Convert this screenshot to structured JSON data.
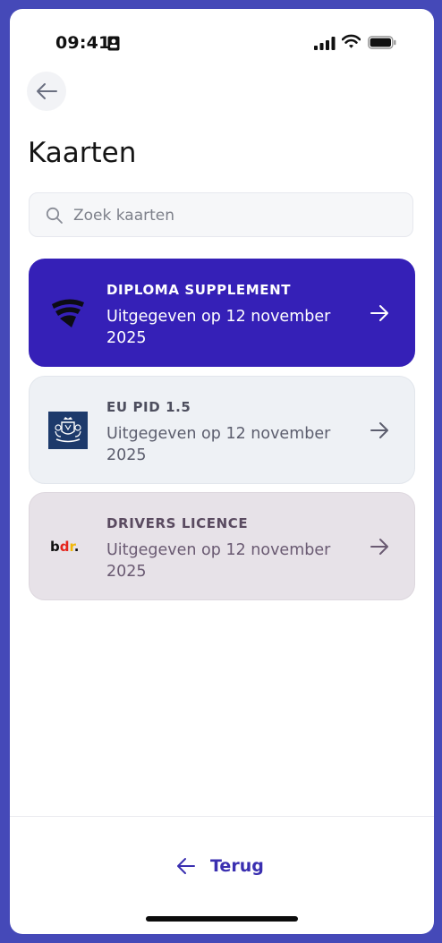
{
  "status_bar": {
    "time": "09:41"
  },
  "header": {
    "title": "Kaarten"
  },
  "search": {
    "placeholder": "Zoek kaarten",
    "value": ""
  },
  "cards": [
    {
      "title": "DIPLOMA SUPPLEMENT",
      "subtitle": "Uitgegeven op 12 november 2025",
      "background": "#3520b7",
      "logo": "wing-logo-icon"
    },
    {
      "title": "EU PID 1.5",
      "subtitle": "Uitgegeven op 12 november 2025",
      "background": "#eef1f5",
      "logo": "coat-of-arms-icon"
    },
    {
      "title": "DRIVERS LICENCE",
      "subtitle": "Uitgegeven op 12 november 2025",
      "background": "#e7e2e8",
      "logo": "bdr-logo-icon",
      "logo_text": "bdr."
    }
  ],
  "footer": {
    "back_label": "Terug"
  },
  "colors": {
    "accent": "#3a2fb0",
    "frame": "#4549b8"
  }
}
